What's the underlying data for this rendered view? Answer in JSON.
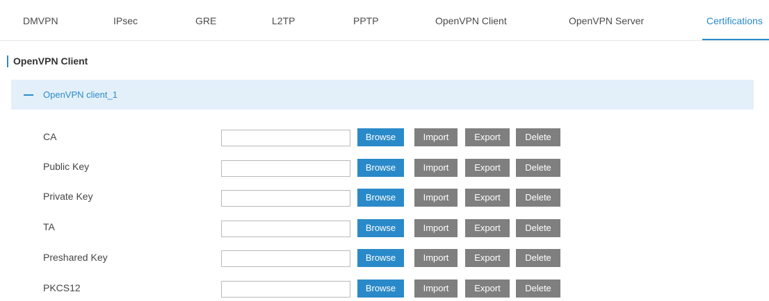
{
  "tabs": [
    {
      "label": "DMVPN",
      "active": false
    },
    {
      "label": "IPsec",
      "active": false
    },
    {
      "label": "GRE",
      "active": false
    },
    {
      "label": "L2TP",
      "active": false
    },
    {
      "label": "PPTP",
      "active": false
    },
    {
      "label": "OpenVPN Client",
      "active": false
    },
    {
      "label": "OpenVPN Server",
      "active": false
    },
    {
      "label": "Certifications",
      "active": true
    }
  ],
  "section_title": "OpenVPN Client",
  "panel": {
    "title": "OpenVPN client_1",
    "collapse_icon": "minus-icon",
    "expanded": true
  },
  "buttons": {
    "browse": "Browse",
    "import": "Import",
    "export": "Export",
    "delete": "Delete"
  },
  "rows": [
    {
      "label": "CA",
      "value": ""
    },
    {
      "label": "Public Key",
      "value": ""
    },
    {
      "label": "Private Key",
      "value": ""
    },
    {
      "label": "TA",
      "value": ""
    },
    {
      "label": "Preshared Key",
      "value": ""
    },
    {
      "label": "PKCS12",
      "value": ""
    }
  ],
  "colors": {
    "accent": "#2a8ac9",
    "panel_bg": "#e3f0fa",
    "secondary_button": "#7f7f7f"
  }
}
